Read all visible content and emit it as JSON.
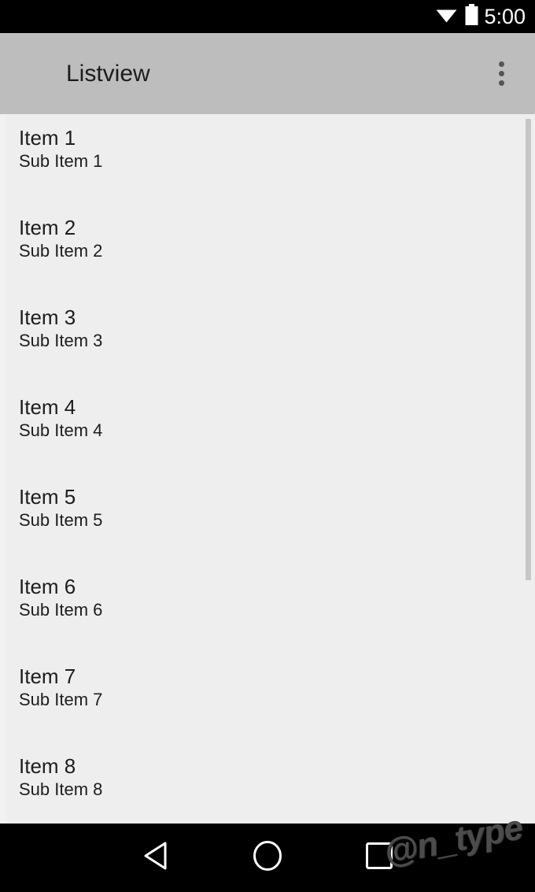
{
  "status_bar": {
    "time": "5:00",
    "icons": [
      "wifi-icon",
      "battery-icon"
    ],
    "background_color": "#000000",
    "foreground_color": "#ffffff"
  },
  "app_bar": {
    "title": "Listview",
    "background_color": "#bdbdbd",
    "title_color": "#1c1c1c",
    "overflow_menu_label": "More options"
  },
  "list": {
    "background_color": "#eeeeee",
    "items": [
      {
        "title": "Item 1",
        "subtitle": "Sub Item 1"
      },
      {
        "title": "Item 2",
        "subtitle": "Sub Item 2"
      },
      {
        "title": "Item 3",
        "subtitle": "Sub Item 3"
      },
      {
        "title": "Item 4",
        "subtitle": "Sub Item 4"
      },
      {
        "title": "Item 5",
        "subtitle": "Sub Item 5"
      },
      {
        "title": "Item 6",
        "subtitle": "Sub Item 6"
      },
      {
        "title": "Item 7",
        "subtitle": "Sub Item 7"
      },
      {
        "title": "Item 8",
        "subtitle": "Sub Item 8"
      }
    ],
    "scrollbar_color": "#c6c6c6"
  },
  "nav_bar": {
    "background_color": "#000000",
    "buttons": [
      {
        "name": "back",
        "icon": "back-triangle-icon"
      },
      {
        "name": "home",
        "icon": "home-circle-icon"
      },
      {
        "name": "recents",
        "icon": "recents-square-icon"
      }
    ]
  },
  "watermark": {
    "text": "@n_type",
    "color": "#4c4c4c"
  }
}
